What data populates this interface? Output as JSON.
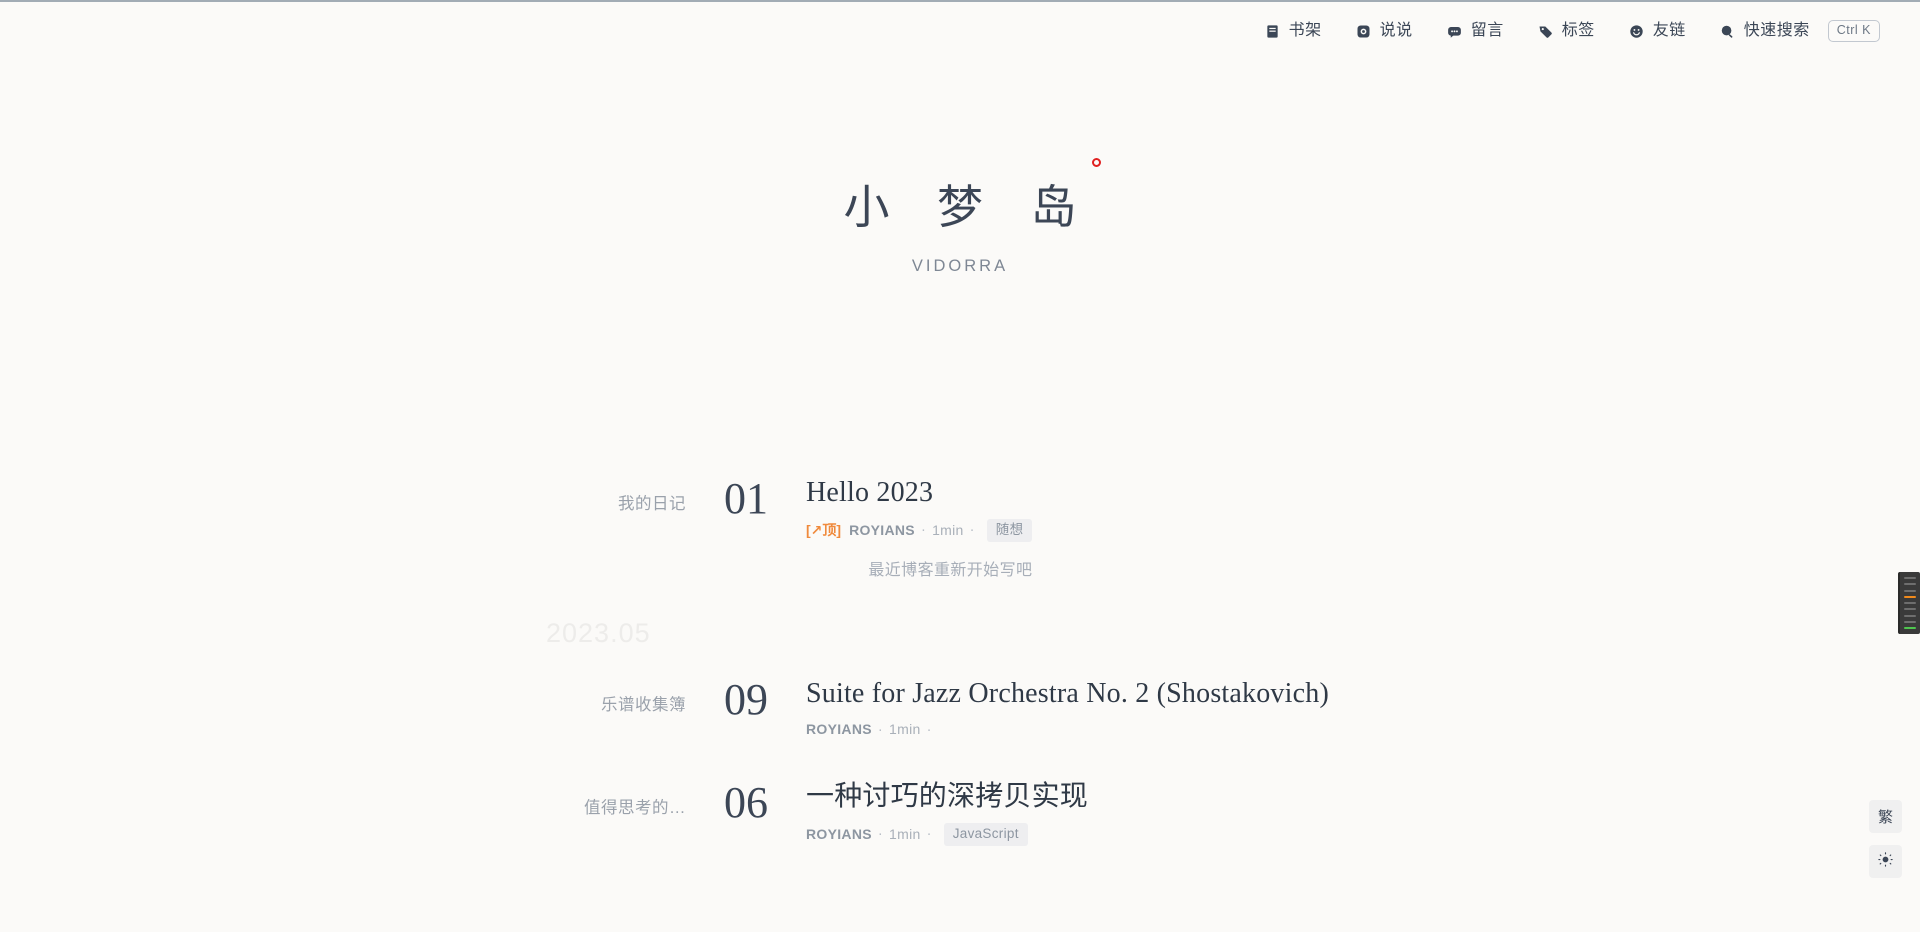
{
  "nav": {
    "items": [
      {
        "label": "书架",
        "icon": "book-icon",
        "name": "nav-item-bookshelf"
      },
      {
        "label": "说说",
        "icon": "camera-icon",
        "name": "nav-item-moments"
      },
      {
        "label": "留言",
        "icon": "message-icon",
        "name": "nav-item-guestbook"
      },
      {
        "label": "标签",
        "icon": "tag-icon",
        "name": "nav-item-tags"
      },
      {
        "label": "友链",
        "icon": "smiley-icon",
        "name": "nav-item-friends"
      },
      {
        "label": "快速搜索",
        "icon": "search-icon",
        "name": "nav-item-search"
      }
    ],
    "shortcut_badge": "Ctrl K"
  },
  "hero": {
    "title": "小 梦 岛",
    "subtitle": "VIDORRA",
    "dot_color": "#e02020"
  },
  "list": {
    "year_separator": "2023.05",
    "posts": [
      {
        "category": "我的日记",
        "day": "01",
        "title": "Hello 2023",
        "pinned_badge": "[↗顶]",
        "author": "ROYIANS",
        "read_time": "1min",
        "separator": "·",
        "tag": "随想",
        "excerpt": "最近博客重新开始写吧"
      },
      {
        "category": "乐谱收集簿",
        "day": "09",
        "title": "Suite for Jazz Orchestra No. 2 (Shostakovich)",
        "pinned_badge": "",
        "author": "ROYIANS",
        "read_time": "1min",
        "separator": "·",
        "tag": "",
        "excerpt": ""
      },
      {
        "category": "值得思考的…",
        "day": "06",
        "title": "一种讨巧的深拷贝实现",
        "pinned_badge": "",
        "author": "ROYIANS",
        "read_time": "1min",
        "separator": "·",
        "tag": "JavaScript",
        "excerpt": ""
      }
    ]
  },
  "float_buttons": [
    {
      "label": "繁",
      "name": "traditional-chinese-toggle"
    },
    {
      "label": "",
      "name": "theme-toggle-button"
    }
  ],
  "colors": {
    "background": "#fbfaf8",
    "text": "#3c4656",
    "muted": "#9aa1ab",
    "accent_orange": "#f08a3c",
    "accent_red": "#e02020"
  }
}
